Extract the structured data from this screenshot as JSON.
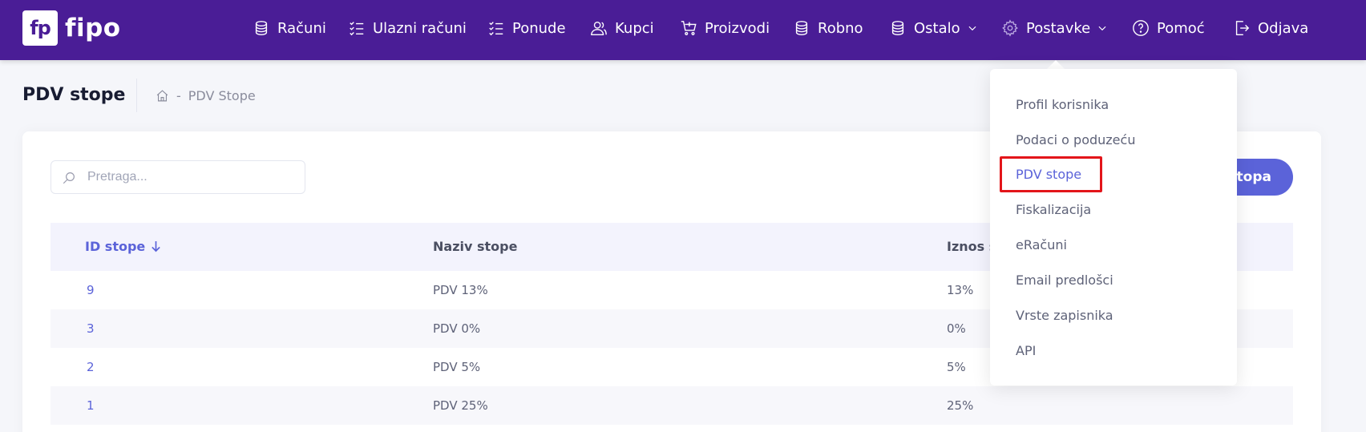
{
  "app": {
    "logo_mark": "fp",
    "logo_text": "fipo"
  },
  "nav": {
    "racuni": {
      "label": "Računi",
      "icon": "coins-icon"
    },
    "ulazni_racuni": {
      "label": "Ulazni računi",
      "icon": "checklist-icon"
    },
    "ponude": {
      "label": "Ponude",
      "icon": "checklist-icon"
    },
    "kupci": {
      "label": "Kupci",
      "icon": "users-icon"
    },
    "proizvodi": {
      "label": "Proizvodi",
      "icon": "cart-icon"
    },
    "robno": {
      "label": "Robno",
      "icon": "coins-icon"
    },
    "ostalo": {
      "label": "Ostalo",
      "icon": "coins-icon"
    },
    "postavke": {
      "label": "Postavke",
      "icon": "gear-icon"
    },
    "pomoc": {
      "label": "Pomoć",
      "icon": "help-icon"
    },
    "odjava": {
      "label": "Odjava",
      "icon": "logout-icon"
    }
  },
  "page": {
    "title": "PDV stope",
    "breadcrumb_current": "PDV Stope"
  },
  "search": {
    "placeholder": "Pretraga..."
  },
  "add_button": {
    "label": "topa"
  },
  "table": {
    "headers": {
      "id": "ID stope",
      "name": "Naziv stope",
      "amount": "Iznos s"
    },
    "rows": [
      {
        "id": "9",
        "name": "PDV 13%",
        "amount": "13%"
      },
      {
        "id": "3",
        "name": "PDV 0%",
        "amount": "0%"
      },
      {
        "id": "2",
        "name": "PDV 5%",
        "amount": "5%"
      },
      {
        "id": "1",
        "name": "PDV 25%",
        "amount": "25%"
      }
    ]
  },
  "settings_menu": {
    "items": [
      "Profil korisnika",
      "Podaci o poduzeću",
      "PDV stope",
      "Fiskalizacija",
      "eRačuni",
      "Email predlošci",
      "Vrste zapisnika",
      "API"
    ]
  },
  "colors": {
    "navbar": "#4a1d96",
    "accent": "#5b63d9",
    "highlight": "#e3151a"
  }
}
